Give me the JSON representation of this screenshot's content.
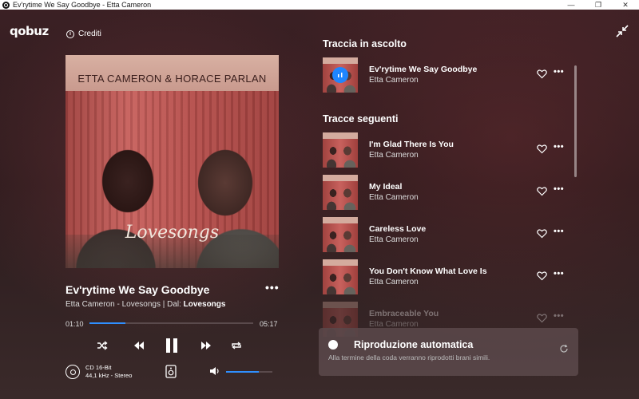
{
  "window": {
    "title": "Ev'rytime We Say Goodbye - Etta Cameron",
    "controls": [
      "—",
      "❐",
      "✕"
    ]
  },
  "header": {
    "logo": "qobuz",
    "credits_label": "Crediti"
  },
  "album_art": {
    "artist_text": "ETTA CAMERON & HORACE PARLAN",
    "title_text": "Lovesongs"
  },
  "now_playing": {
    "title": "Ev'rytime We Say Goodbye",
    "subtitle_prefix": "Etta Cameron - Lovesongs | Dal: ",
    "album_link": "Lovesongs",
    "more": "•••",
    "time_current": "01:10",
    "time_total": "05:17",
    "progress_fraction": 0.22
  },
  "quality": {
    "line1": "CD 16-Bit",
    "line2": "44,1 kHz - Stereo"
  },
  "volume": {
    "level_fraction": 0.7
  },
  "queue": {
    "now_label": "Traccia in ascolto",
    "current": {
      "title": "Ev'rytime We Say Goodbye",
      "artist": "Etta Cameron"
    },
    "next_label": "Tracce seguenti",
    "next": [
      {
        "title": "I'm Glad There Is You",
        "artist": "Etta Cameron"
      },
      {
        "title": "My Ideal",
        "artist": "Etta Cameron"
      },
      {
        "title": "Careless Love",
        "artist": "Etta Cameron"
      },
      {
        "title": "You Don't Know What Love Is",
        "artist": "Etta Cameron"
      },
      {
        "title": "Embraceable You",
        "artist": "Etta Cameron"
      }
    ],
    "row_more": "•••"
  },
  "autoplay": {
    "title": "Riproduzione automatica",
    "description": "Alla termine della coda verranno riprodotti brani simili."
  },
  "colors": {
    "accent": "#2f8fff",
    "background": "#2c1b1d"
  }
}
